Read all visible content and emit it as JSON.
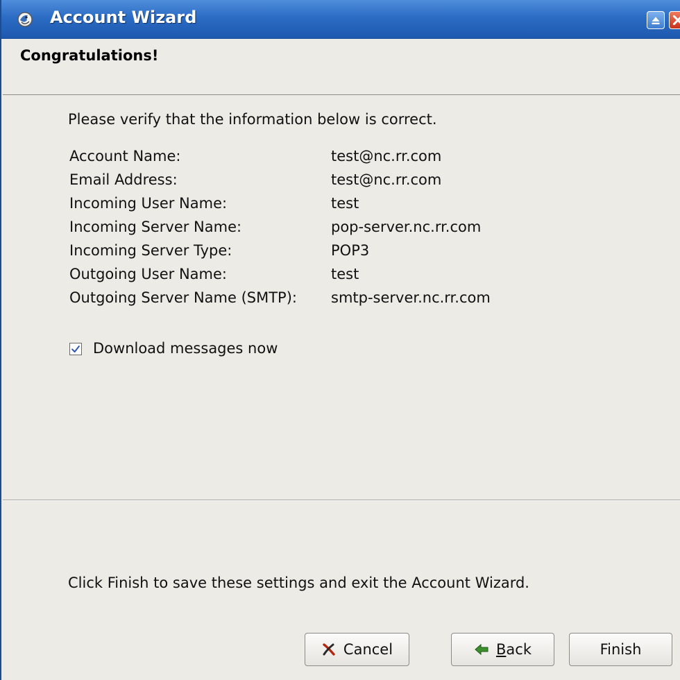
{
  "window": {
    "title": "Account Wizard"
  },
  "header": {
    "title": "Congratulations!"
  },
  "content": {
    "intro": "Please verify that the information below is correct.",
    "summary": [
      {
        "label": "Account Name:",
        "value": "test@nc.rr.com"
      },
      {
        "label": "Email Address:",
        "value": "test@nc.rr.com"
      },
      {
        "label": "Incoming User Name:",
        "value": "test"
      },
      {
        "label": "Incoming Server Name:",
        "value": "pop-server.nc.rr.com"
      },
      {
        "label": "Incoming Server Type:",
        "value": "POP3"
      },
      {
        "label": "Outgoing User Name:",
        "value": "test"
      },
      {
        "label": "Outgoing Server Name (SMTP):",
        "value": "smtp-server.nc.rr.com"
      }
    ],
    "download_checkbox": {
      "label": "Download messages now",
      "checked": true
    },
    "footer_note": "Click Finish to save these settings and exit the Account Wizard."
  },
  "buttons": {
    "cancel": "Cancel",
    "back": "Back",
    "finish": "Finish"
  },
  "icons": {
    "app": "thunderbird-icon",
    "maximize": "maximize-icon",
    "close": "close-icon",
    "cancel": "red-x-icon",
    "back": "left-arrow-icon",
    "checkbox": "checkmark-icon"
  },
  "colors": {
    "titlebar": "#2c6cc4",
    "window_bg": "#edebe6",
    "check": "#2b57b0",
    "cancel_x": "#b52810",
    "back_arrow": "#3e8f2e"
  }
}
